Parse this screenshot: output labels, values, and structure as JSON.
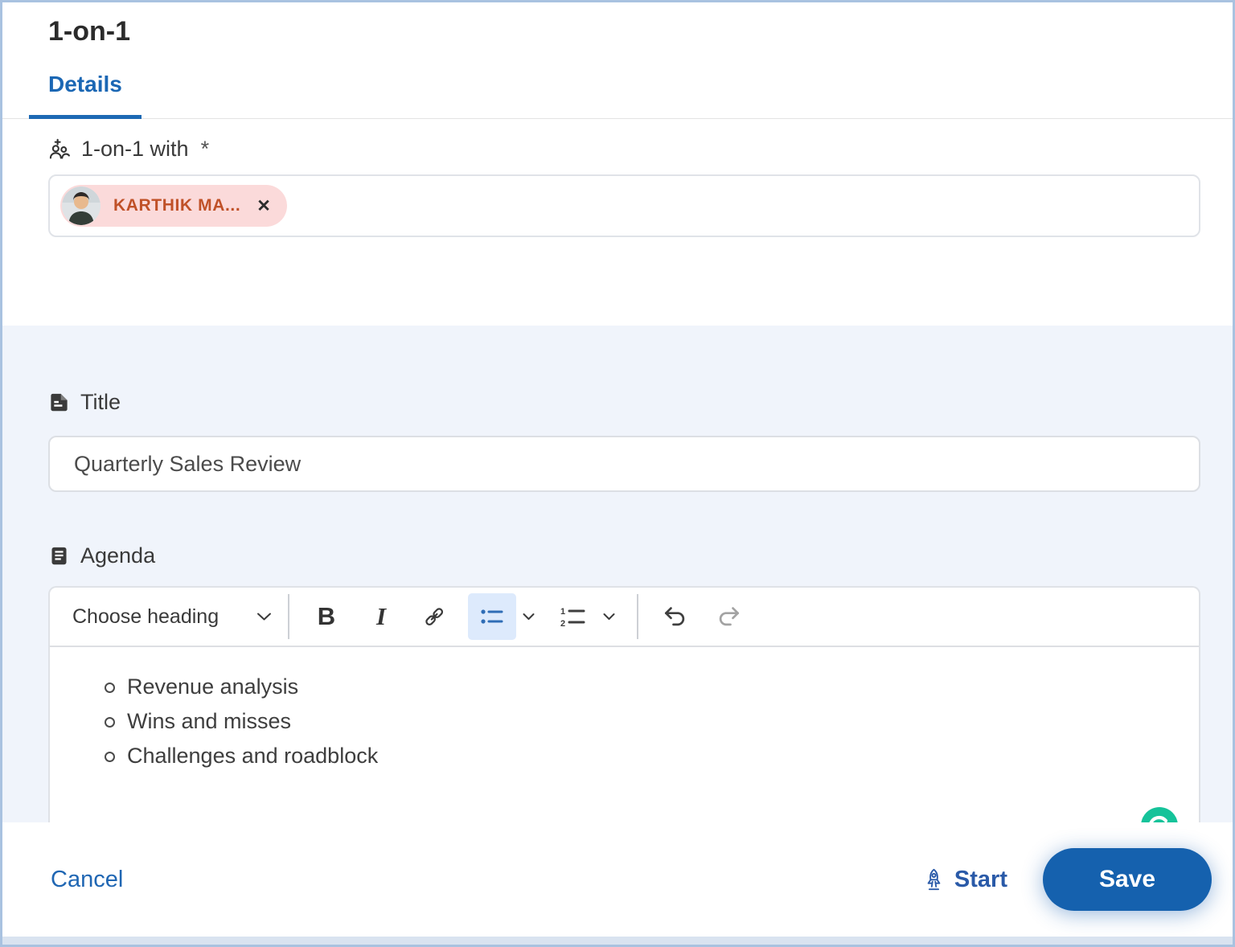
{
  "header": {
    "title": "1-on-1"
  },
  "tabs": {
    "details": "Details"
  },
  "form": {
    "with_label": "1-on-1 with",
    "required_marker": "*",
    "participant_chip": {
      "name": "KARTHIK MA...",
      "remove_glyph": "✕"
    },
    "title_label": "Title",
    "title_value": "Quarterly Sales Review",
    "agenda_label": "Agenda"
  },
  "editor": {
    "heading_select_label": "Choose heading",
    "bold_label": "B",
    "italic_label": "I",
    "numbered_icon_digits": {
      "one": "1",
      "two": "2"
    },
    "agenda_items": [
      "Revenue analysis",
      "Wins and misses",
      "Challenges and roadblock"
    ]
  },
  "footer": {
    "cancel_label": "Cancel",
    "start_label": "Start",
    "save_label": "Save"
  },
  "icons": [
    "group-add-icon",
    "document-icon",
    "agenda-icon",
    "chevron-down-icon",
    "link-icon",
    "bullet-list-icon",
    "numbered-list-icon",
    "undo-icon",
    "redo-icon",
    "close-icon",
    "rocket-icon",
    "grammarly-icon"
  ],
  "colors": {
    "accent_blue": "#1b67b4",
    "save_button_blue": "#1561ae",
    "section_background": "#f0f4fb",
    "chip_background": "#fbdada",
    "chip_text": "#c05128",
    "active_tool_background": "#ddeafc",
    "grammarly_green": "#15c39a"
  }
}
